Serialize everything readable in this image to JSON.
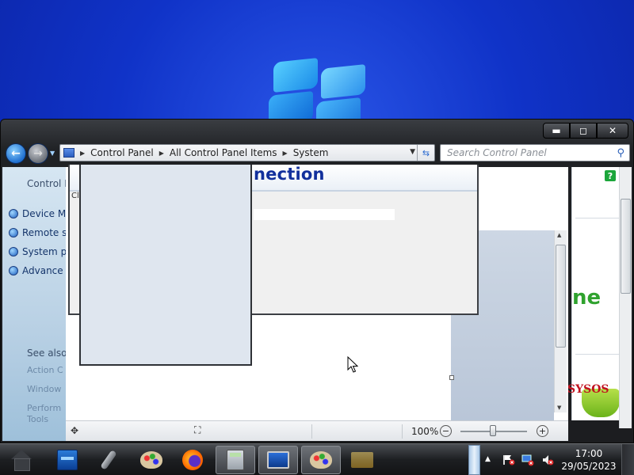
{
  "window": {
    "controls": {
      "minimize": "▬",
      "maximize": "◻",
      "close": "✕"
    }
  },
  "address": {
    "crumbs": [
      "Control Panel",
      "All Control Panel Items",
      "System"
    ]
  },
  "search": {
    "placeholder": "Search Control Panel"
  },
  "leftpane": {
    "home": "Control P",
    "items": [
      "Device M",
      "Remote s",
      "System p",
      "Advance"
    ],
    "see_also": "See also",
    "see_also_items": [
      "Action C",
      "Window",
      "Perform",
      "Tools"
    ]
  },
  "dialog": {
    "heading": "nection",
    "fragment": "Cl"
  },
  "rightpane": {
    "logo_text": "ne",
    "brand": "SYSOS"
  },
  "statusbar": {
    "zoom": "100%"
  },
  "taskbar": {
    "items": [
      "home-icon",
      "file-cabinet-icon",
      "microphone-icon",
      "paint-icon",
      "firefox-icon",
      "calculator-icon",
      "computer-icon",
      "palette-icon",
      "folder-icon"
    ],
    "active_indices": [
      5,
      6,
      7
    ]
  },
  "clock": {
    "time": "17:00",
    "date": "29/05/2023"
  },
  "colors": {
    "desktop": "#1033c8",
    "dialog_heading": "#12309c",
    "brand_red": "#c1121f",
    "logo_green": "#2fa22e"
  }
}
